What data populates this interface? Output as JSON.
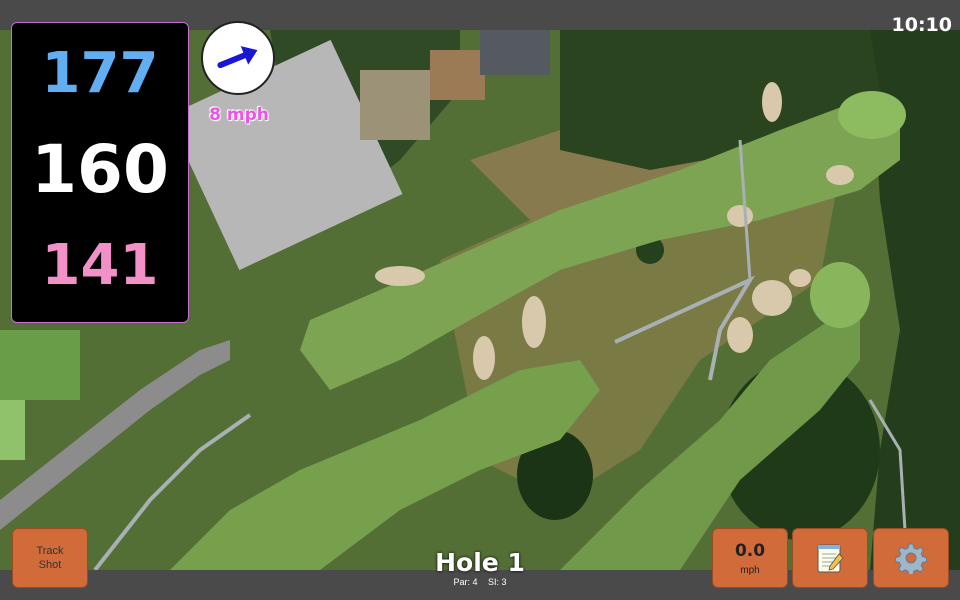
{
  "status_bar": {
    "time": "10:10"
  },
  "distances": {
    "back": "177",
    "middle": "160",
    "front": "141"
  },
  "distance_colors": {
    "back": "#62aef2",
    "middle": "#ffffff",
    "front": "#f290c8"
  },
  "wind": {
    "speed_text": "8 mph",
    "direction_icon": "arrow-icon"
  },
  "hole": {
    "title": "Hole 1",
    "par": "Par: 4",
    "stroke_index": "SI: 3"
  },
  "buttons": {
    "track_shot": "Track\nShot",
    "wind_value": "0.0",
    "wind_unit": "mph",
    "scorecard_icon": "notepad-icon",
    "settings_icon": "gear-icon"
  },
  "colors": {
    "button_bg": "#d26b3a",
    "panel_border": "#c96cd6"
  }
}
